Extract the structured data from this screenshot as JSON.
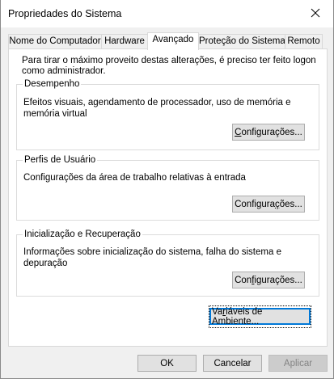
{
  "window": {
    "title": "Propriedades do Sistema",
    "close_icon": "close-icon"
  },
  "tabs": [
    {
      "label": "Nome do Computador"
    },
    {
      "label": "Hardware"
    },
    {
      "label": "Avançado",
      "active": true
    },
    {
      "label": "Proteção do Sistema"
    },
    {
      "label": "Remoto"
    }
  ],
  "panel": {
    "intro": "Para tirar o máximo proveito destas alterações, é preciso ter feito logon como administrador.",
    "groups": [
      {
        "title": "Desempenho",
        "description": "Efeitos visuais, agendamento de processador, uso de memória e memória virtual",
        "button_label_pre": "",
        "button_label_u": "C",
        "button_label_post": "onfigurações..."
      },
      {
        "title": "Perfis de Usuário",
        "description": "Configurações da área de trabalho relativas à entrada",
        "button_label_pre": "Configura",
        "button_label_u": "ç",
        "button_label_post": "ões..."
      },
      {
        "title": "Inicialização e Recuperação",
        "description": "Informações sobre inicialização do sistema, falha do sistema e depuração",
        "button_label_pre": "Con",
        "button_label_u": "f",
        "button_label_post": "igurações..."
      }
    ],
    "env_button_pre": "Va",
    "env_button_u": "r",
    "env_button_post": "iáveis de Ambiente..."
  },
  "footer": {
    "ok_label": "OK",
    "cancel_label": "Cancelar",
    "apply_label": "Aplicar"
  }
}
